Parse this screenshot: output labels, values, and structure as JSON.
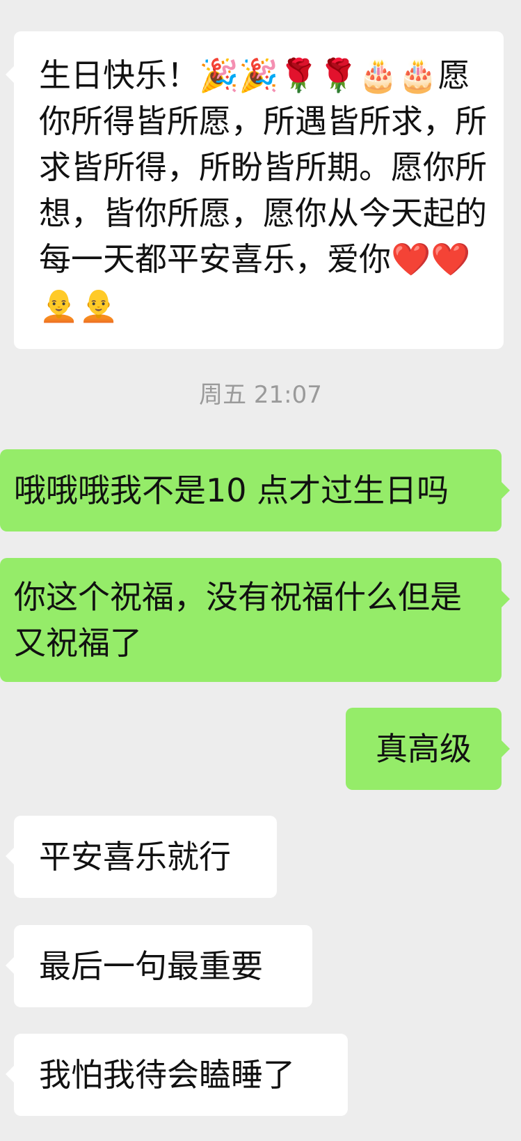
{
  "messages": [
    {
      "id": "m1",
      "direction": "incoming",
      "text": "生日快乐！🎉🎉🌹🌹🎂🎂愿你所得皆所愿，所遇皆所求，所求皆所得，所盼皆所期。愿你所想，皆你所愿，愿你从今天起的每一天都平安喜乐，爱你❤️❤️🧑‍🦲🧑‍🦲"
    },
    {
      "id": "ts1",
      "type": "timestamp",
      "text": "周五 21:07"
    },
    {
      "id": "m2",
      "direction": "outgoing",
      "text": "哦哦哦我不是10 点才过生日吗"
    },
    {
      "id": "m3",
      "direction": "outgoing",
      "text": "你这个祝福，没有祝福什么但是又祝福了"
    },
    {
      "id": "m4",
      "direction": "outgoing",
      "text": "真高级"
    },
    {
      "id": "m5",
      "direction": "incoming",
      "text": "平安喜乐就行"
    },
    {
      "id": "m6",
      "direction": "incoming",
      "text": "最后一句最重要"
    },
    {
      "id": "m7",
      "direction": "incoming",
      "text": "我怕我待会瞌睡了"
    }
  ],
  "colors": {
    "background": "#ededed",
    "incoming_bubble": "#ffffff",
    "outgoing_bubble": "#95ec69",
    "timestamp_text": "#9a9a9a"
  }
}
